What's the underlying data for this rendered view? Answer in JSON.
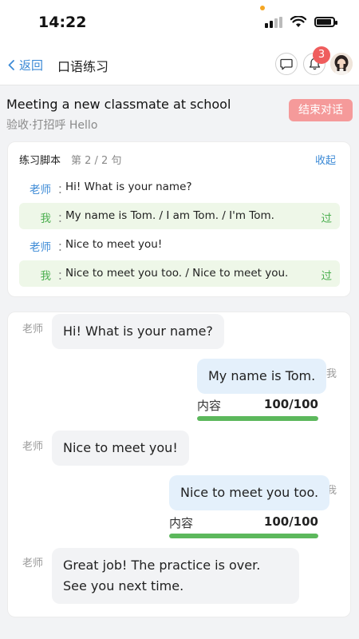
{
  "status": {
    "time": "14:22",
    "wifi_icon": "wifi-icon",
    "battery_icon": "battery-icon",
    "signal_icon": "signal-icon"
  },
  "nav": {
    "back_label": "返回",
    "title": "口语练习",
    "notification_count": "3"
  },
  "lesson": {
    "title": "Meeting a new classmate at school",
    "subtitle": "验收·打招呼 Hello",
    "end_button": "结束对话"
  },
  "script": {
    "heading": "练习脚本",
    "progress": "第 2 / 2 句",
    "collapse_label": "收起",
    "lines": [
      {
        "speaker": "老师",
        "colon": "：",
        "text": "Hi! What is your name?",
        "status": ""
      },
      {
        "speaker": "我",
        "colon": "：",
        "text": "My name is Tom. / I am Tom. / I'm Tom.",
        "status": "过"
      },
      {
        "speaker": "老师",
        "colon": "：",
        "text": "Nice to meet you!",
        "status": ""
      },
      {
        "speaker": "我",
        "colon": "：",
        "text": "Nice to meet you too. / Nice to meet you.",
        "status": "过"
      }
    ]
  },
  "chat": {
    "messages": [
      {
        "from": "老师",
        "text": "Hi! What is your name?"
      },
      {
        "from": "我",
        "text": "My name is Tom.",
        "score_label": "内容",
        "score": "100/100",
        "score_fraction": 1.0
      },
      {
        "from": "老师",
        "text": "Nice to meet you!"
      },
      {
        "from": "我",
        "text": "Nice to meet you too.",
        "score_label": "内容",
        "score": "100/100",
        "score_fraction": 1.0
      },
      {
        "from": "老师",
        "text": "Great job! The practice is over. See you next time."
      }
    ]
  },
  "colors": {
    "accent": "#3c8ad6",
    "success": "#4caf50",
    "danger": "#f59a9a",
    "badge": "#ef5d5d"
  }
}
